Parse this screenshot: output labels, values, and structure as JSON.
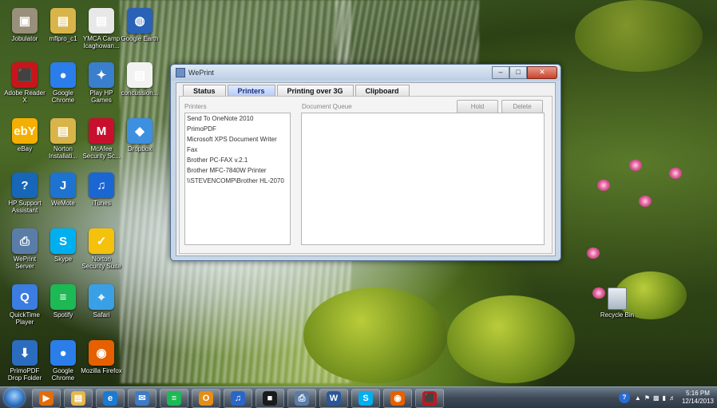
{
  "desktop": {
    "icons_col1": [
      {
        "label": "Jobulator",
        "glyph": "▣",
        "color": "#9a8f7a"
      },
      {
        "label": "Adobe Reader X",
        "glyph": "⬛",
        "color": "#c8151b"
      },
      {
        "label": "eBay",
        "glyph": "ebY",
        "color": "#f5af02"
      },
      {
        "label": "HP Support Assistant",
        "glyph": "?",
        "color": "#1766b8"
      },
      {
        "label": "WePrint Server",
        "glyph": "⎙",
        "color": "#5a7da8"
      },
      {
        "label": "QuickTime Player",
        "glyph": "Q",
        "color": "#3b7de0"
      },
      {
        "label": "PrimoPDF Drop Folder",
        "glyph": "⬇",
        "color": "#2b6cbf"
      }
    ],
    "icons_col2": [
      {
        "label": "mflpro_c1",
        "glyph": "▤",
        "color": "#d8b44a"
      },
      {
        "label": "Google Chrome",
        "glyph": "●",
        "color": "#2b7de9"
      },
      {
        "label": "Norton Installati...",
        "glyph": "▤",
        "color": "#d8b44a"
      },
      {
        "label": "WeMote",
        "glyph": "J",
        "color": "#1e73d1"
      },
      {
        "label": "Skype",
        "glyph": "S",
        "color": "#00aff0"
      },
      {
        "label": "Spotify",
        "glyph": "≡",
        "color": "#1db954"
      },
      {
        "label": "Google Chrome",
        "glyph": "●",
        "color": "#2b7de9"
      }
    ],
    "icons_col3": [
      {
        "label": "YMCA Camp Icaghowan...",
        "glyph": "▤",
        "color": "#e8e8e8"
      },
      {
        "label": "Play HP Games",
        "glyph": "✦",
        "color": "#3a7fce"
      },
      {
        "label": "McAfee Security Sc...",
        "glyph": "M",
        "color": "#c8102e"
      },
      {
        "label": "iTunes",
        "glyph": "♫",
        "color": "#1a66d3"
      },
      {
        "label": "Norton Security Suite",
        "glyph": "✓",
        "color": "#f4c20d"
      },
      {
        "label": "Safari",
        "glyph": "⌖",
        "color": "#3aa0e6"
      },
      {
        "label": "Mozilla Firefox",
        "glyph": "◉",
        "color": "#e66000"
      }
    ],
    "icons_col4": [
      {
        "label": "Google Earth",
        "glyph": "◍",
        "color": "#2a62b8"
      },
      {
        "label": "concussion...",
        "glyph": "▤",
        "color": "#f2f2f2"
      },
      {
        "label": "Dropbox",
        "glyph": "◆",
        "color": "#3d8fe0"
      }
    ],
    "recycle_bin": "Recycle Bin"
  },
  "window": {
    "title": "WePrint",
    "tabs": [
      "Status",
      "Printers",
      "Printing over 3G",
      "Clipboard"
    ],
    "active_tab": "Printers",
    "printers_label": "Printers",
    "queue_label": "Document Queue",
    "hold_button": "Hold",
    "delete_button": "Delete",
    "printers": [
      "Send To OneNote 2010",
      "PrimoPDF",
      "Microsoft XPS Document Writer",
      "Fax",
      "Brother PC-FAX v.2.1",
      "Brother MFC-7840W Printer",
      "\\\\STEVENCOMP\\Brother HL-2070"
    ]
  },
  "taskbar": {
    "items": [
      {
        "name": "media-player-icon",
        "glyph": "▶",
        "color": "#e36c0a"
      },
      {
        "name": "file-explorer-icon",
        "glyph": "▤",
        "color": "#e5b84c"
      },
      {
        "name": "internet-explorer-icon",
        "glyph": "e",
        "color": "#1b7ad3"
      },
      {
        "name": "mail-icon",
        "glyph": "✉",
        "color": "#3e7bc4"
      },
      {
        "name": "spotify-icon",
        "glyph": "≡",
        "color": "#1db954"
      },
      {
        "name": "outlook-icon",
        "glyph": "O",
        "color": "#e38d1a"
      },
      {
        "name": "itunes-icon",
        "glyph": "♫",
        "color": "#2a66c8"
      },
      {
        "name": "black-app-icon",
        "glyph": "■",
        "color": "#1a1a1a"
      },
      {
        "name": "weprint-icon",
        "glyph": "⎙",
        "color": "#5a7da8"
      },
      {
        "name": "word-icon",
        "glyph": "W",
        "color": "#2b579a"
      },
      {
        "name": "skype-icon",
        "glyph": "S",
        "color": "#00aff0"
      },
      {
        "name": "firefox-icon",
        "glyph": "◉",
        "color": "#e66000"
      },
      {
        "name": "adobe-reader-icon",
        "glyph": "⬛",
        "color": "#c8151b"
      }
    ],
    "time": "5:16 PM",
    "date": "12/14/2013"
  }
}
